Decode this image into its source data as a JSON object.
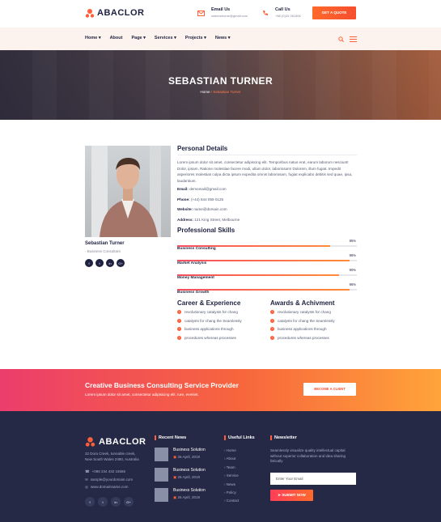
{
  "brand": {
    "name": "ABACLOR",
    "accent": "#ff5f3a",
    "dark": "#1e2140"
  },
  "contact": {
    "email_label": "Email Us",
    "email_value": "webershome@gmail.com",
    "call_label": "Call Us",
    "call_value": "+88 (0)34 061806",
    "quote_button": "GET A QUOTE"
  },
  "nav": {
    "items": [
      {
        "label": "Home",
        "icon": "chevron-down"
      },
      {
        "label": "About",
        "icon": ""
      },
      {
        "label": "Page",
        "icon": "chevron-down"
      },
      {
        "label": "Services",
        "icon": "chevron-down"
      },
      {
        "label": "Projects",
        "icon": "chevron-down"
      },
      {
        "label": "News",
        "icon": "chevron-down"
      }
    ]
  },
  "hero": {
    "title": "SEBASTIAN TURNER",
    "crumb_home": "Home",
    "crumb_sep": "/",
    "crumb_current": "Sebastian Turner"
  },
  "profile": {
    "name": "Sebastian Turner",
    "role": "- Business Consultant",
    "socials": [
      "f",
      "t",
      "in",
      "G+"
    ]
  },
  "personal": {
    "heading": "Personal Details",
    "bio": "Lorem ipsum dolor sit amet, consectetur adipiscing elit. Temporibus natus erat, earum laborum nesciunt! Dolor, ipsam. Ratione molestiae facere modi, ullam dolor, laboriosam! Dolorem, illum fugiat. Impedit asperiores molestias culpa dicta ipsum expedita omnis laboriosam, fugiat explicabo debitis sed quae, ipsa, laudantium.",
    "details": [
      {
        "label": "Email:",
        "value": "demomail@gmail.com"
      },
      {
        "label": "Phone:",
        "value": "(+44) 844 059 0125"
      },
      {
        "label": "Website:",
        "value": "name@domain.com"
      },
      {
        "label": "Address:",
        "value": "121 King Street, Melbourne"
      }
    ]
  },
  "skills": {
    "heading": "Professional Skills",
    "items": [
      {
        "name": "Business Consulting",
        "pct_label": "85%",
        "pct": 85
      },
      {
        "name": "Market Analysis",
        "pct_label": "96%",
        "pct": 96
      },
      {
        "name": "Money Management",
        "pct_label": "90%",
        "pct": 90
      },
      {
        "name": "Business Growth",
        "pct_label": "96%",
        "pct": 96
      }
    ]
  },
  "career": {
    "heading": "Career & Experience",
    "items": [
      "revolutionary catalysts for chang",
      "catalysts for chang the Seamlessly",
      "business applications through",
      "procedures whereas processes"
    ]
  },
  "awards": {
    "heading": "Awards & Achivment",
    "items": [
      "revolutionary catalysts for chang",
      "catalysts for chang the Seamlessly",
      "business applications through",
      "procedures whereas processes"
    ]
  },
  "cta": {
    "title": "Creative Business Consulting Service Provider",
    "subtitle": "Lorem ipsum dolor sit amet, consectetur adipisicing elit. Iure, eveniet.",
    "button": "BECOME A CLIENT"
  },
  "footer": {
    "address": [
      "32 Dora Creek, tunnable creek,",
      "New South Wales 2480, Australia"
    ],
    "phone": "+088 234 432 15565",
    "email": "sample@yourdomain.com",
    "website": "www.domainname.com",
    "recent_news": {
      "heading": "Recent News",
      "items": [
        {
          "title": "Business Solution",
          "date": "26 April, 2019"
        },
        {
          "title": "Business Solution",
          "date": "26 April, 2019"
        },
        {
          "title": "Business Solution",
          "date": "26 April, 2019"
        }
      ]
    },
    "useful_links": {
      "heading": "Useful Links",
      "items": [
        "Home",
        "About",
        "Team",
        "Service",
        "News",
        "Policy",
        "Contact"
      ]
    },
    "newsletter": {
      "heading": "Newsletter",
      "text": "Seamlessly visualize quality intellectual capital without superior collaboration and idea sharing listically",
      "placeholder": "Enter Your Email",
      "button": "SUBMIT NOW"
    },
    "socials": [
      "f",
      "t",
      "in",
      "G+"
    ]
  }
}
